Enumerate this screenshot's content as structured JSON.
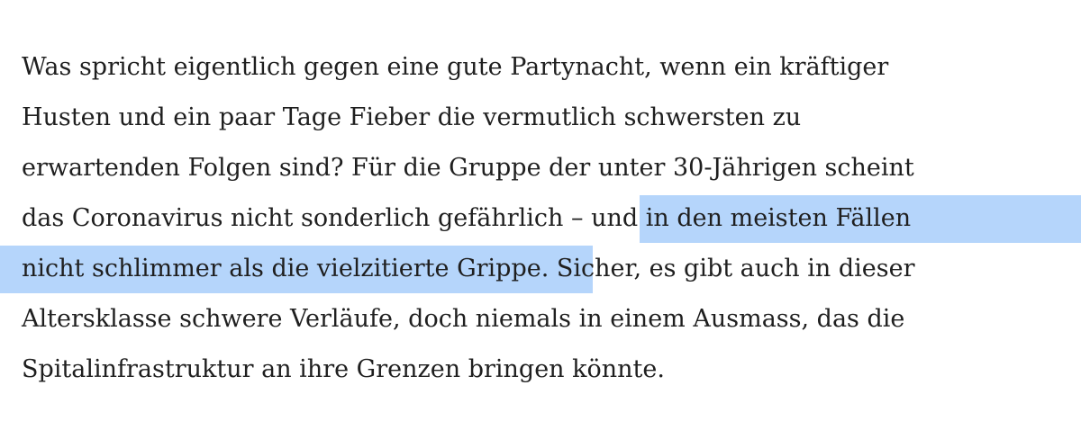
{
  "article": {
    "lines": [
      "Was spricht eigentlich gegen eine gute Partynacht, wenn ein kräftiger",
      "Husten und ein paar Tage Fieber die vermutlich schwersten zu",
      "erwartenden Folgen sind? Für die Gruppe der unter 30-Jährigen scheint"
    ],
    "line4_plain": "das Coronavirus nicht sonderlich gefährlich – ",
    "line4_selected": "und in den meisten Fällen",
    "line5_selected": "nicht schlimmer als die vielzitierte Grippe.",
    "line5_plain": " Sicher, es gibt auch in dieser",
    "line6": "Altersklasse schwere Verläufe, doch niemals in einem Ausmass, das die",
    "line7": "Spitalinfrastruktur an ihre Grenzen bringen könnte."
  },
  "colors": {
    "text": "#1f1f1f",
    "selection": "#b5d5fb",
    "background": "#ffffff"
  }
}
